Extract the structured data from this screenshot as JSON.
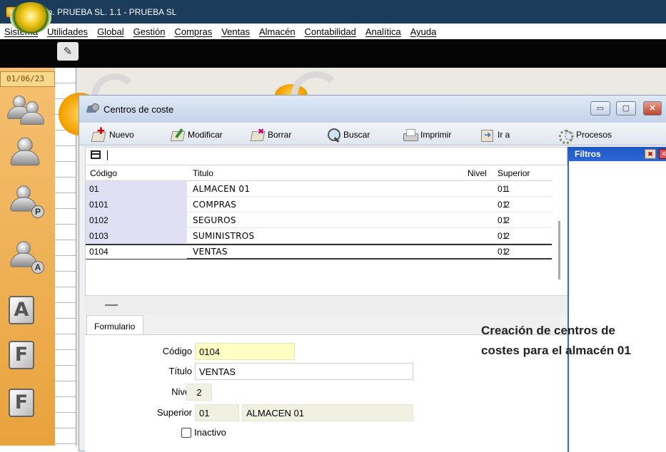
{
  "app": {
    "title": "Gestión. PRUEBA SL. 1.1 - PRUEBA SL"
  },
  "menu": [
    "Sistema",
    "Utilidades",
    "Global",
    "Gestión",
    "Compras",
    "Ventas",
    "Almacén",
    "Contabilidad",
    "Analítica",
    "Ayuda"
  ],
  "sidebar": {
    "date": "01/06/23",
    "letters": [
      "A",
      "F",
      "F"
    ],
    "badges": [
      "P",
      "A"
    ]
  },
  "window": {
    "title": "Centros de coste",
    "buttons": {
      "minimize": "▭",
      "maximize": "▢",
      "close": "✕"
    },
    "toolbar": {
      "nuevo": "Nuevo",
      "modificar": "Modificar",
      "borrar": "Borrar",
      "buscar": "Buscar",
      "imprimir": "Imprimir",
      "ir_a": "Ir a",
      "procesos": "Procesos"
    }
  },
  "grid": {
    "columns": {
      "codigo": "Código",
      "titulo": "Titulo",
      "nivel": "Nivel",
      "superior": "Superior"
    },
    "rows": [
      {
        "codigo": "01",
        "titulo": "ALMACEN 01",
        "nivel": "1",
        "superior": "01"
      },
      {
        "codigo": "0101",
        "titulo": "COMPRAS",
        "nivel": "2",
        "superior": "01"
      },
      {
        "codigo": "0102",
        "titulo": "SEGUROS",
        "nivel": "2",
        "superior": "01"
      },
      {
        "codigo": "0103",
        "titulo": "SUMINISTROS",
        "nivel": "2",
        "superior": "01"
      },
      {
        "codigo": "0104",
        "titulo": "VENTAS",
        "nivel": "2",
        "superior": "01"
      }
    ],
    "selected_index": 4
  },
  "form": {
    "tab": "Formulario",
    "labels": {
      "codigo": "Código",
      "titulo": "Título",
      "nivel": "Nivel",
      "superior": "Superior",
      "inactivo": "Inactivo"
    },
    "values": {
      "codigo": "0104",
      "titulo": "VENTAS",
      "nivel": "2",
      "superior": "01",
      "superior_desc": "ALMACEN 01",
      "inactivo": false
    }
  },
  "filters": {
    "title": "Filtros"
  },
  "annotation": {
    "line1": "Creación de centros de",
    "line2": "costes para el almacén 01"
  },
  "colors": {
    "titlebar": "#1c3c5c",
    "filters": "#2c6bd6",
    "sidebar": "#e9a23c",
    "code_cell": "#e0e0f5",
    "field_yellow": "#ffffc4"
  }
}
